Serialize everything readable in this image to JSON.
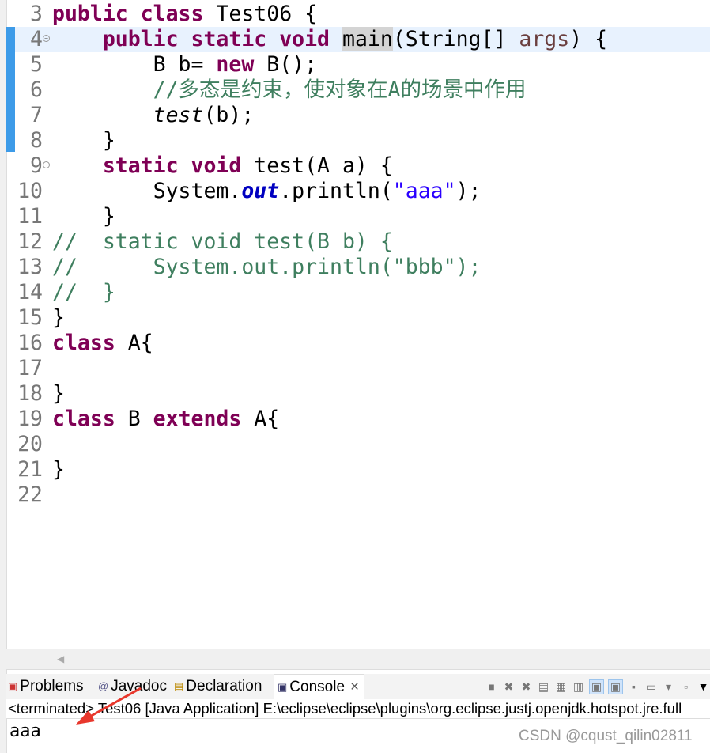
{
  "editor": {
    "lines": [
      {
        "n": "3",
        "tokens": [
          [
            "kw",
            "public"
          ],
          [
            "",
            ""
          ],
          [
            "kw",
            " class"
          ],
          [
            "",
            " Test06 {"
          ]
        ]
      },
      {
        "n": "4",
        "fold": true,
        "current": true,
        "tokens": [
          [
            "",
            "    "
          ],
          [
            "kw",
            "public static void"
          ],
          [
            "",
            " "
          ],
          [
            "hl",
            "ma"
          ],
          [
            "hl",
            "in"
          ],
          [
            "",
            "(String[] "
          ],
          [
            "pm",
            "args"
          ],
          [
            "",
            ") {"
          ]
        ]
      },
      {
        "n": "5",
        "tokens": [
          [
            "",
            "        B b= "
          ],
          [
            "kw",
            "new"
          ],
          [
            "",
            " B();"
          ]
        ]
      },
      {
        "n": "6",
        "tokens": [
          [
            "",
            "        "
          ],
          [
            "cm",
            "//多态是约束，使对象在A的场景中作用"
          ]
        ]
      },
      {
        "n": "7",
        "tokens": [
          [
            "",
            "        "
          ],
          [
            "it",
            "test"
          ],
          [
            "",
            "(b);"
          ]
        ]
      },
      {
        "n": "8",
        "tokens": [
          [
            "",
            "    }"
          ]
        ]
      },
      {
        "n": "9",
        "fold": true,
        "tokens": [
          [
            "",
            "    "
          ],
          [
            "kw",
            "static void"
          ],
          [
            "",
            " test(A a) {"
          ]
        ]
      },
      {
        "n": "10",
        "tokens": [
          [
            "",
            "        System."
          ],
          [
            "fd",
            "out"
          ],
          [
            "",
            ".println("
          ],
          [
            "st",
            "\"aaa\""
          ],
          [
            "",
            ");"
          ]
        ]
      },
      {
        "n": "11",
        "tokens": [
          [
            "",
            "    }"
          ]
        ]
      },
      {
        "n": "12",
        "tokens": [
          [
            "cm",
            "//  static void test(B b) {"
          ]
        ]
      },
      {
        "n": "13",
        "tokens": [
          [
            "cm",
            "//      System.out.println(\"bbb\");"
          ]
        ]
      },
      {
        "n": "14",
        "tokens": [
          [
            "cm",
            "//  }"
          ]
        ]
      },
      {
        "n": "15",
        "tokens": [
          [
            "",
            "}"
          ]
        ]
      },
      {
        "n": "16",
        "tokens": [
          [
            "kw",
            "class"
          ],
          [
            "",
            " A{"
          ]
        ]
      },
      {
        "n": "17",
        "tokens": []
      },
      {
        "n": "18",
        "tokens": [
          [
            "",
            "}"
          ]
        ]
      },
      {
        "n": "19",
        "tokens": [
          [
            "kw",
            "class"
          ],
          [
            "",
            " B "
          ],
          [
            "kw",
            "extends"
          ],
          [
            "",
            " A{"
          ]
        ]
      },
      {
        "n": "20",
        "tokens": []
      },
      {
        "n": "21",
        "tokens": [
          [
            "",
            "}"
          ]
        ]
      },
      {
        "n": "22",
        "tokens": []
      }
    ]
  },
  "tabs": [
    {
      "label": "Problems",
      "icon": "problems-icon"
    },
    {
      "label": "Javadoc",
      "icon": "javadoc-icon"
    },
    {
      "label": "Declaration",
      "icon": "declaration-icon"
    },
    {
      "label": "Console",
      "icon": "console-icon",
      "active": true,
      "close": "×"
    }
  ],
  "console": {
    "status": "<terminated> Test06 [Java Application] E:\\eclipse\\eclipse\\plugins\\org.eclipse.justj.openjdk.hotspot.jre.full",
    "output": "aaa"
  },
  "watermark": "CSDN @cqust_qilin02811",
  "colors": {
    "keyword": "#7f0055",
    "comment": "#3f7f5f",
    "string": "#2a00ff",
    "field": "#0000c0",
    "annotation_arrow": "#e8372c"
  }
}
